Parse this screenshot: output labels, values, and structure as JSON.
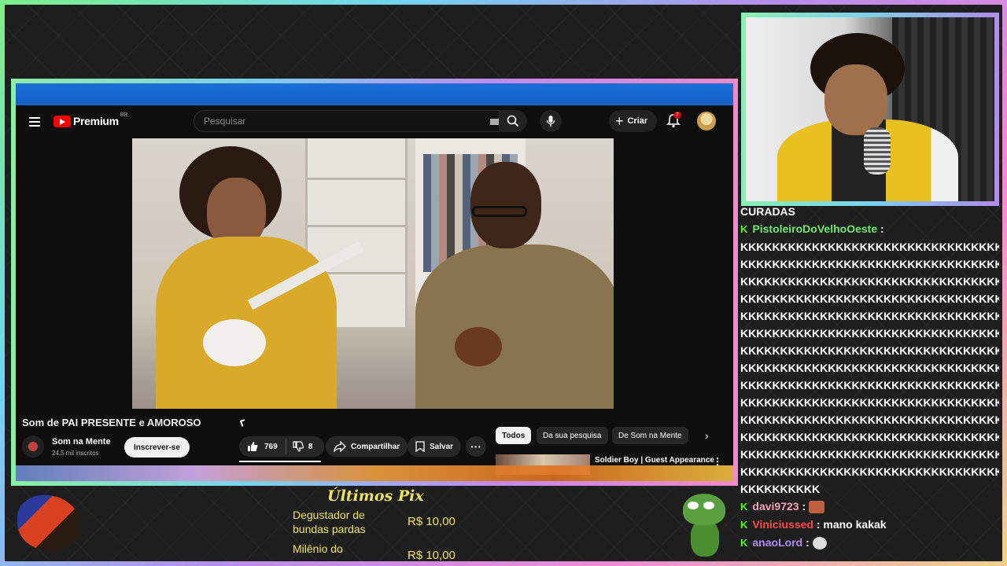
{
  "youtube": {
    "logo_text": "Premium",
    "logo_region": "BR",
    "search_placeholder": "Pesquisar",
    "create_label": "Criar",
    "notifications_count": "7",
    "video_title": "Som de PAI PRESENTE e AMOROSO",
    "channel_name": "Som na Mente",
    "channel_subs": "24,5 mil inscritos",
    "subscribe_label": "Inscrever-se",
    "likes": "769",
    "dislikes": "8",
    "share_label": "Compartilhar",
    "save_label": "Salvar",
    "chips": [
      "Todos",
      "Da sua pesquisa",
      "De Som na Mente"
    ],
    "recommendation_title": "Soldier Boy | Guest Appearance"
  },
  "chat": {
    "header": "CURADAS",
    "messages": [
      {
        "user": "PistoleiroDoVelhoOeste",
        "text": ":"
      },
      {
        "user": "davi9723",
        "text": ":"
      },
      {
        "user": "Viniciussed",
        "text": ": mano kakak"
      },
      {
        "user": "anaoLord",
        "text": ":"
      }
    ],
    "spam_lines": [
      "KKKKKKKKKKKKKKKKKKKKKKKKKKKKKKKKKKKKKKKK",
      "KKKKKKKKKKKKKKKKKKKKKKKKKKKKKKKKKKKKKKKK",
      "KKKKKKKKKKKKKKKKKKKKKKKKKKKKKKKKKKKKKKKK",
      "KKKKKKKKKKKKKKKKKKKKKKKKKKKKKKKKKKKKKKKK",
      "KKKKKKKKKKKKKKKKKKKKKKKKKKKKKKKKKKKKKKKK",
      "KKKKKKKKKKKKKKKKKKKKKKKKKKKKKKKKKKKKKKKK",
      "KKKKKKKKKKKKKKKKKKKKKKKKKKKKKKKKKKKKKKKK",
      "KKKKKKKKKKKKKKKKKKKKKKKKKKKKKKKKKKKKKKKK",
      "KKKKKKKKKKKKKKKKKKKKKKKKKKKKKKKKKKKKKKKK",
      "KKKKKKKKKKKKKKKKKKKKKKKKKKKKKKKKKKKKKKKK",
      "KKKKKKKKKKKKKKKKKKKKKKKKKKKKKKKKKKKKKKKK",
      "KKKKKKKKKKKKKKKKKKKKKKKKKKKKKKKKKKKKKKKK",
      "KKKKKKKKKKKKKKKKKKKKKKKKKKKKKKKKKKKKKKKK",
      "KKKKKKKKKKKKKKKKKKKKKKKKKKKKKKKKKKKKKKKK",
      "KKKKKKKKKK"
    ]
  },
  "pix": {
    "title": "Últimos Pix",
    "entries": [
      {
        "name": "Degustador de bundas pardas",
        "amount": "R$ 10,00"
      },
      {
        "name": "Milênio do",
        "amount": "R$ 10,00"
      }
    ]
  },
  "colors": {
    "kick_green": "#53fc18",
    "pix_yellow": "#f0e860",
    "yt_red": "#ff0000"
  }
}
